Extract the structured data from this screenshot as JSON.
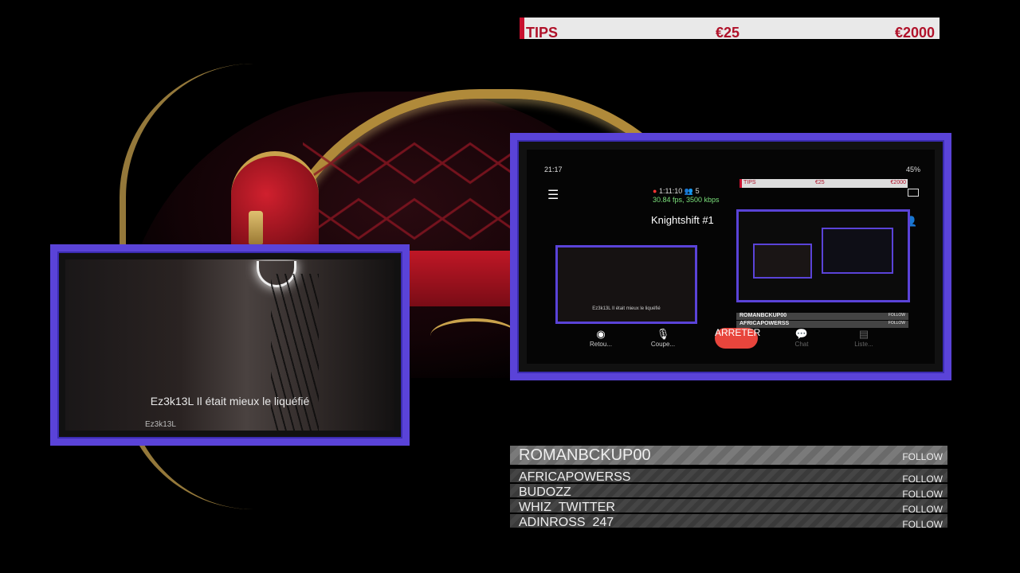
{
  "tips": {
    "label": "TIPS",
    "current": "€25",
    "goal": "€2000"
  },
  "left_panel": {
    "caption": "Ez3k13L Il était mieux le liquéfié",
    "watermark": "Ez3k13L"
  },
  "phone": {
    "time": "21:17",
    "battery": "45%",
    "duration": "1:11:10",
    "viewers": "5",
    "fps": "30.84 fps, 3500 kbps",
    "channel": "Knightshift #1",
    "mini_tips": {
      "label": "TIPS",
      "current": "€25",
      "goal": "€2000"
    },
    "mini_caption": "Ez3k13L Il était mieux le liquéfié",
    "mini_list": [
      "ROMANBCKUP00",
      "AFRICAPOWERSS",
      "BUDOZZ",
      "WHIZ_TWITTER",
      "ADINROSS_247"
    ],
    "mini_follow": "FOLLOW",
    "controls": {
      "back": "Retou...",
      "mute": "Coupe...",
      "stop": "ARRETER",
      "chat": "Chat",
      "list": "Liste..."
    }
  },
  "follow_list": {
    "follow_label": "FOLLOW",
    "items": [
      "ROMANBCKUP00",
      "AFRICAPOWERSS",
      "BUDOZZ",
      "WHIZ_TWITTER",
      "ADINROSS_247"
    ]
  }
}
